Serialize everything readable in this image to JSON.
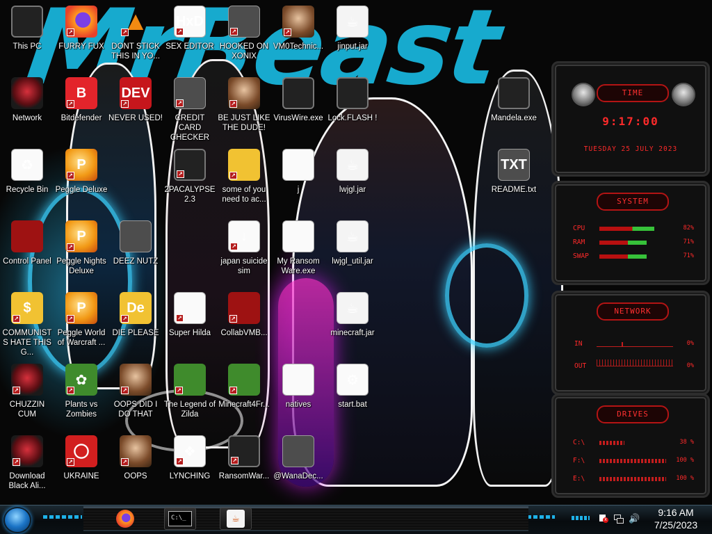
{
  "wallpaper": {
    "brush_text": "MrBeast",
    "accent": "#18b3d9"
  },
  "desktop_icons": [
    {
      "id": "this-pc",
      "label": "This PC",
      "icon": "monitor-icon"
    },
    {
      "id": "furry-fux",
      "label": "FURRY FUX",
      "icon": "firefox-icon"
    },
    {
      "id": "dont-stick",
      "label": "DONT STICK THIS IN YO...",
      "icon": "vlc-cone-icon"
    },
    {
      "id": "sex-editor",
      "label": "SEX EDITOR",
      "icon": "hxd-editor-icon"
    },
    {
      "id": "hooked-on-xonix",
      "label": "HOOKED ON XONIX",
      "icon": "xonix-game-icon"
    },
    {
      "id": "vm0technic",
      "label": "VM0Technic...",
      "icon": "doctor-avatar-icon"
    },
    {
      "id": "jinput-jar",
      "label": "jinput.jar",
      "icon": "java-icon"
    },
    {
      "id": "network",
      "label": "Network",
      "icon": "alien-orb-icon"
    },
    {
      "id": "bitdefender",
      "label": "Bitdefender",
      "icon": "bitdefender-icon"
    },
    {
      "id": "never-used",
      "label": "NEVER USED!",
      "icon": "dev-cpp-icon"
    },
    {
      "id": "credit-card-checker",
      "label": "CREDIT CARD CHECKER",
      "icon": "credit-card-icon"
    },
    {
      "id": "be-just-like-the-dude",
      "label": "BE JUST LIKE THE DUDE!",
      "icon": "santa-avatar-icon"
    },
    {
      "id": "viruswire",
      "label": "VirusWire.exe",
      "icon": "alien-monitor-icon"
    },
    {
      "id": "lock-flash",
      "label": "Lock.FLASH !",
      "icon": "alien-monitor-icon"
    },
    {
      "id": "mandela",
      "label": "Mandela.exe",
      "icon": "alien-monitor-icon"
    },
    {
      "id": "recycle-bin",
      "label": "Recycle Bin",
      "icon": "recycle-bin-icon"
    },
    {
      "id": "peggle-deluxe",
      "label": "Peggle Deluxe",
      "icon": "peggle-icon"
    },
    {
      "id": "2pacalypse",
      "label": "2PACALYPSE 2.3",
      "icon": "alien-monitor-icon"
    },
    {
      "id": "some-of-you",
      "label": "some of you need to ac...",
      "icon": "cartoon-dog-icon"
    },
    {
      "id": "j",
      "label": "j",
      "icon": "file-icon"
    },
    {
      "id": "lwjgl-jar",
      "label": "lwjgl.jar",
      "icon": "java-icon"
    },
    {
      "id": "readme",
      "label": "README.txt",
      "icon": "txt-file-icon"
    },
    {
      "id": "control-panel",
      "label": "Control Panel",
      "icon": "control-panel-icon"
    },
    {
      "id": "peggle-nights",
      "label": "Peggle Nights Deluxe",
      "icon": "peggle-icon"
    },
    {
      "id": "deez-nutz",
      "label": "DEEZ NUTZ",
      "icon": "folder-stack-icon"
    },
    {
      "id": "japan-suicide-sim",
      "label": "japan suicide sim",
      "icon": "installer-file-icon"
    },
    {
      "id": "my-ransomware",
      "label": "My Ransom Ware.exe",
      "icon": "window-app-icon"
    },
    {
      "id": "lwjgl-util-jar",
      "label": "lwjgl_util.jar",
      "icon": "java-icon"
    },
    {
      "id": "communists",
      "label": "COMMUNISTS HATE THIS G...",
      "icon": "money-bag-icon"
    },
    {
      "id": "peggle-world-of-warcraft",
      "label": "Peggle World of Warcraft ...",
      "icon": "peggle-icon"
    },
    {
      "id": "die-please",
      "label": "DIE PLEASE",
      "icon": "die-logo-icon"
    },
    {
      "id": "super-hilda",
      "label": "Super Hilda",
      "icon": "pixel-art-icon"
    },
    {
      "id": "collabvmb",
      "label": "CollabVMB...",
      "icon": "collabvm-icon"
    },
    {
      "id": "minecraft-jar",
      "label": "minecraft.jar",
      "icon": "java-icon"
    },
    {
      "id": "chuzzin-cum",
      "label": "CHUZZIN CUM",
      "icon": "chuzzle-icon"
    },
    {
      "id": "plants-vs-zombies",
      "label": "Plants vs Zombies",
      "icon": "flower-icon"
    },
    {
      "id": "oops-did-i",
      "label": "OOPS DID I DO THAT",
      "icon": "portrait-icon"
    },
    {
      "id": "legend-of-zilda",
      "label": "The Legend of Zilda",
      "icon": "pixel-hero-icon"
    },
    {
      "id": "minecraft4fr",
      "label": "Minecraft4Fr...",
      "icon": "grass-block-icon"
    },
    {
      "id": "natives",
      "label": "natives",
      "icon": "folder-icon"
    },
    {
      "id": "start-bat",
      "label": "start.bat",
      "icon": "gear-file-icon"
    },
    {
      "id": "download-black-ali",
      "label": "Download Black Ali...",
      "icon": "alien-orb-icon"
    },
    {
      "id": "ukraine",
      "label": "UKRAINE",
      "icon": "radiation-icon"
    },
    {
      "id": "oops",
      "label": "OOPS",
      "icon": "portrait-icon"
    },
    {
      "id": "lynching",
      "label": "LYNCHING",
      "icon": "rope-icon"
    },
    {
      "id": "ransomwar",
      "label": "RansomWar...",
      "icon": "alien-monitor-icon"
    },
    {
      "id": "wanadec",
      "label": "@WanaDec...",
      "icon": "dark-window-icon"
    }
  ],
  "gadget": {
    "time": {
      "header": "TIME",
      "value": "9:17:00",
      "date": "TUESDAY 25 JULY 2023"
    },
    "system": {
      "header": "SYSTEM",
      "rows": [
        {
          "label": "CPU",
          "value": "82%",
          "level": 0.82
        },
        {
          "label": "RAM",
          "value": "71%",
          "level": 0.71
        },
        {
          "label": "SWAP",
          "value": "71%",
          "level": 0.71
        }
      ]
    },
    "network": {
      "header": "NETWORK",
      "rows": [
        {
          "label": "IN",
          "value": "0%"
        },
        {
          "label": "OUT",
          "value": "0%"
        }
      ]
    },
    "drives": {
      "header": "DRIVES",
      "rows": [
        {
          "label": "C:\\",
          "value": "38 %",
          "level": 0.38
        },
        {
          "label": "F:\\",
          "value": "100 %",
          "level": 1.0
        },
        {
          "label": "E:\\",
          "value": "100 %",
          "level": 1.0
        }
      ]
    },
    "color": "#ff2a2a"
  },
  "taskbar": {
    "apps": [
      {
        "name": "firefox",
        "icon": "firefox-icon"
      },
      {
        "name": "command-prompt",
        "icon": "command-prompt-icon",
        "text": "C:\\_"
      },
      {
        "name": "java",
        "icon": "java-icon"
      }
    ],
    "clock_time": "9:16 AM",
    "clock_date": "7/25/2023",
    "tray": [
      "flag-alert-icon",
      "network-icon",
      "speaker-icon"
    ]
  }
}
